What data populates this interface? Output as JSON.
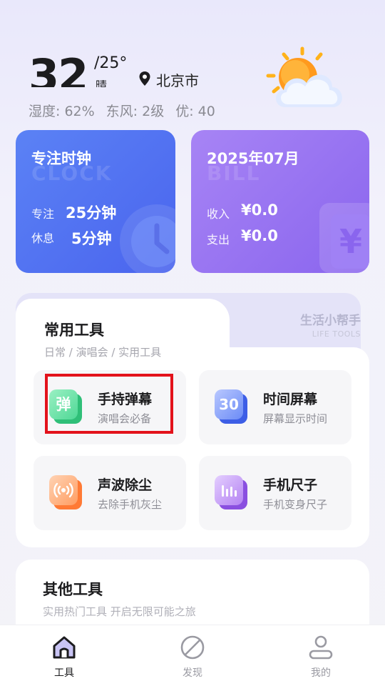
{
  "weather": {
    "temperature": "32",
    "range": "/25°",
    "condition": "晴",
    "city": "北京市",
    "stats": [
      "湿度: 62%",
      "东风: 2级",
      "优: 40"
    ]
  },
  "focus_card": {
    "title": "专注时钟",
    "ghost": "CLOCK",
    "focus_label": "专注",
    "focus_value": "25分钟",
    "rest_label": "休息",
    "rest_value": "5分钟"
  },
  "bill_card": {
    "title": "2025年07月",
    "ghost": "BILL",
    "income_label": "收入",
    "income_value": "¥0.0",
    "expense_label": "支出",
    "expense_value": "¥0.0",
    "icon_glyph": "¥"
  },
  "tools": {
    "title": "常用工具",
    "subtitle": "日常 / 演唱会 / 实用工具",
    "helper_cn": "生活小帮手",
    "helper_en": "LIFE TOOLS",
    "items": [
      {
        "name": "手持弹幕",
        "desc": "演唱会必备",
        "glyph": "弹",
        "color": "#3fcf8e"
      },
      {
        "name": "时间屏幕",
        "desc": "屏幕显示时间",
        "glyph": "30",
        "color": "#4a6ef0"
      },
      {
        "name": "声波除尘",
        "desc": "去除手机灰尘",
        "glyph": "",
        "color": "#ff8a4c"
      },
      {
        "name": "手机尺子",
        "desc": "手机变身尺子",
        "glyph": "",
        "color": "#9b62e8"
      }
    ]
  },
  "other": {
    "title": "其他工具",
    "subtitle": "实用热门工具 开启无限可能之旅"
  },
  "nav": [
    {
      "label": "工具",
      "active": true
    },
    {
      "label": "发现",
      "active": false
    },
    {
      "label": "我的",
      "active": false
    }
  ]
}
